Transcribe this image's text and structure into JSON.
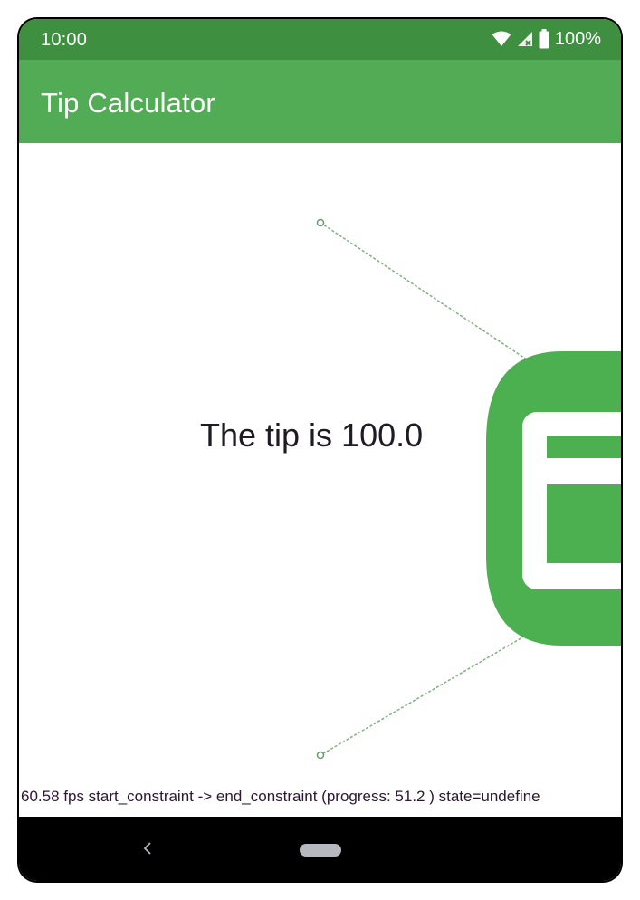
{
  "status_bar": {
    "time": "10:00",
    "battery": "100%",
    "icons": [
      "wifi-icon",
      "cell-signal-no-service-icon",
      "battery-icon"
    ]
  },
  "app_bar": {
    "title": "Tip Calculator"
  },
  "content": {
    "tip_text": "The tip is 100.0",
    "icons": [
      "receipt-icon"
    ]
  },
  "debug_overlay": {
    "text": "60.58 fps start_constraint -> end_constraint (progress: 51.2 ) state=undefine",
    "progress": 51.2
  },
  "nav_bar": {
    "icons": [
      "back-icon",
      "home-pill"
    ]
  },
  "colors": {
    "status_bar": "#3f8f40",
    "app_bar": "#52ab55",
    "accent_green": "#4caf50",
    "nav_bar": "#000000"
  }
}
